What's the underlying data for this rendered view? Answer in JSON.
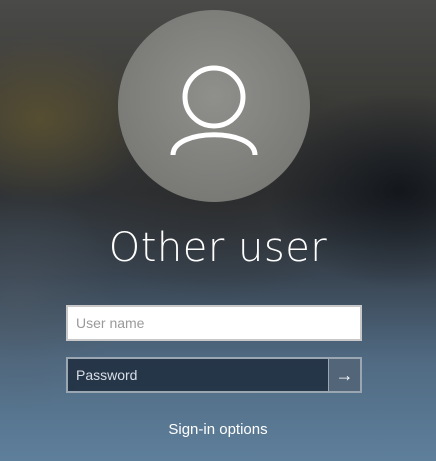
{
  "user": {
    "display_name": "Other user",
    "avatar_icon": "person-icon"
  },
  "form": {
    "username_placeholder": "User name",
    "username_value": "",
    "password_placeholder": "Password",
    "password_value": "",
    "submit_icon": "arrow-right-icon",
    "submit_glyph": "→"
  },
  "links": {
    "signin_options": "Sign-in options"
  },
  "colors": {
    "field_border": "#c8c8c8",
    "password_bg": "#1e2d3e"
  }
}
